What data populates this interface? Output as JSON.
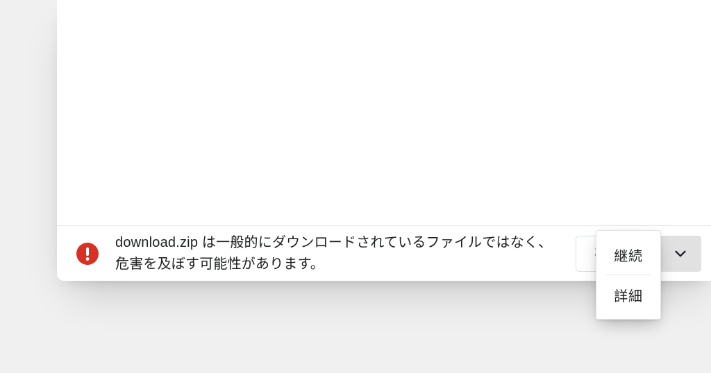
{
  "download_bar": {
    "filename": "download.zip",
    "warning_prefix": " は一般的にダウンロードされているファイルではなく、危害を及ぼす可能性があります。",
    "discard_label": "破棄",
    "icon_color": "#d93025",
    "menu": {
      "continue_label": "継続",
      "details_label": "詳細"
    }
  }
}
